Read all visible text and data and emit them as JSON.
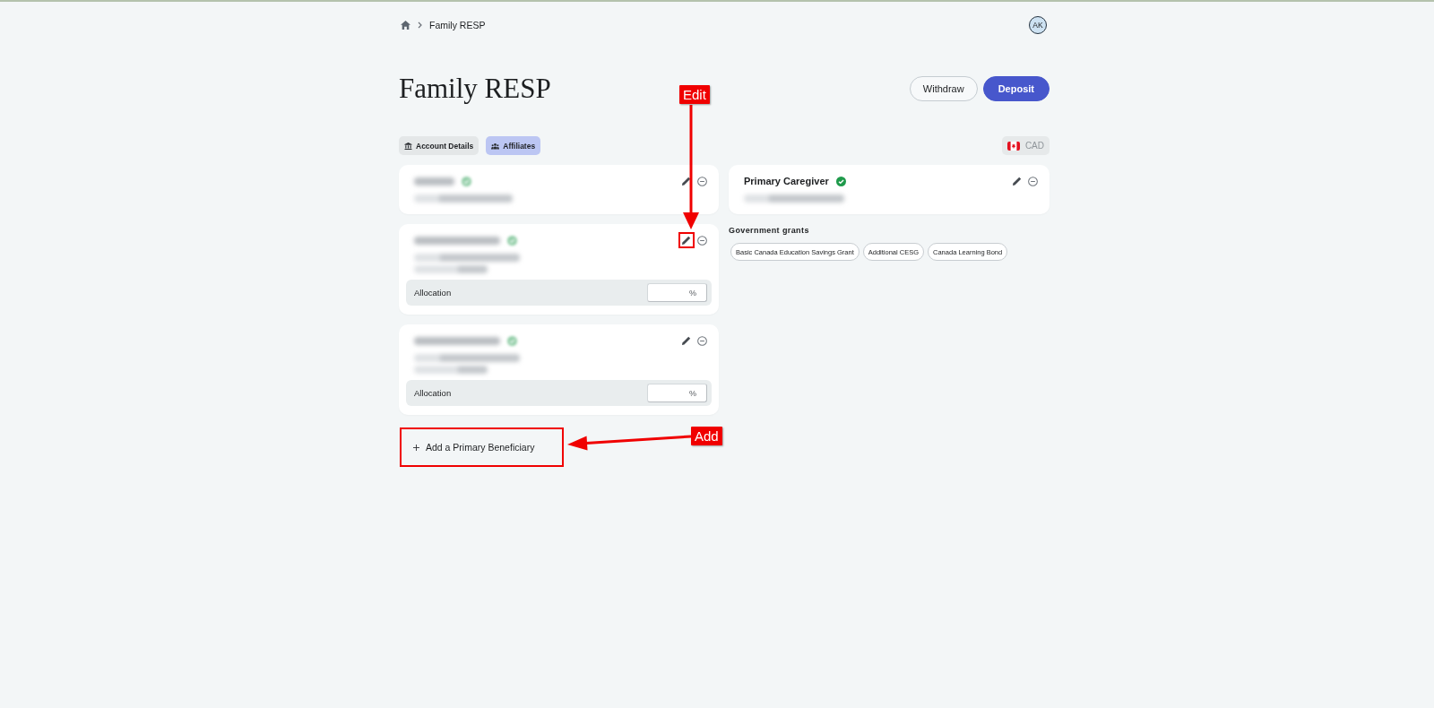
{
  "breadcrumb": {
    "items": [
      {
        "label": "Family RESP"
      }
    ]
  },
  "user": {
    "initials": "AK"
  },
  "header": {
    "title": "Family RESP",
    "buttons": [
      {
        "label": "Withdraw",
        "kind": "secondary"
      },
      {
        "label": "Deposit",
        "kind": "primary"
      }
    ]
  },
  "tabs": [
    {
      "label": "Account Details",
      "selected": false
    },
    {
      "label": "Affiliates",
      "selected": true
    }
  ],
  "currency": {
    "code": "CAD",
    "disabled": true
  },
  "affiliates": [
    {
      "kind": "contact",
      "redacted": true,
      "verified": true,
      "edit_highlighted": false
    },
    {
      "kind": "beneficiary",
      "redacted": true,
      "verified": true,
      "edit_highlighted": true,
      "allocation": {
        "label": "Allocation",
        "suffix": "%"
      }
    },
    {
      "kind": "beneficiary",
      "redacted": true,
      "verified": true,
      "edit_highlighted": false,
      "allocation": {
        "label": "Allocation",
        "suffix": "%"
      }
    }
  ],
  "add_button": {
    "label": "Add a Primary Beneficiary",
    "highlighted": true
  },
  "caregiver": {
    "title": "Primary Caregiver",
    "verified": true,
    "redacted_detail": true,
    "edit_highlighted": false
  },
  "grants": {
    "title": "Government grants",
    "items": [
      "Basic Canada Education Savings Grant",
      "Additional CESG",
      "Canada Learning Bond"
    ]
  },
  "annotations": [
    {
      "kind": "arrow-down",
      "label": "Edit"
    },
    {
      "kind": "arrow-left",
      "label": "Add"
    }
  ]
}
